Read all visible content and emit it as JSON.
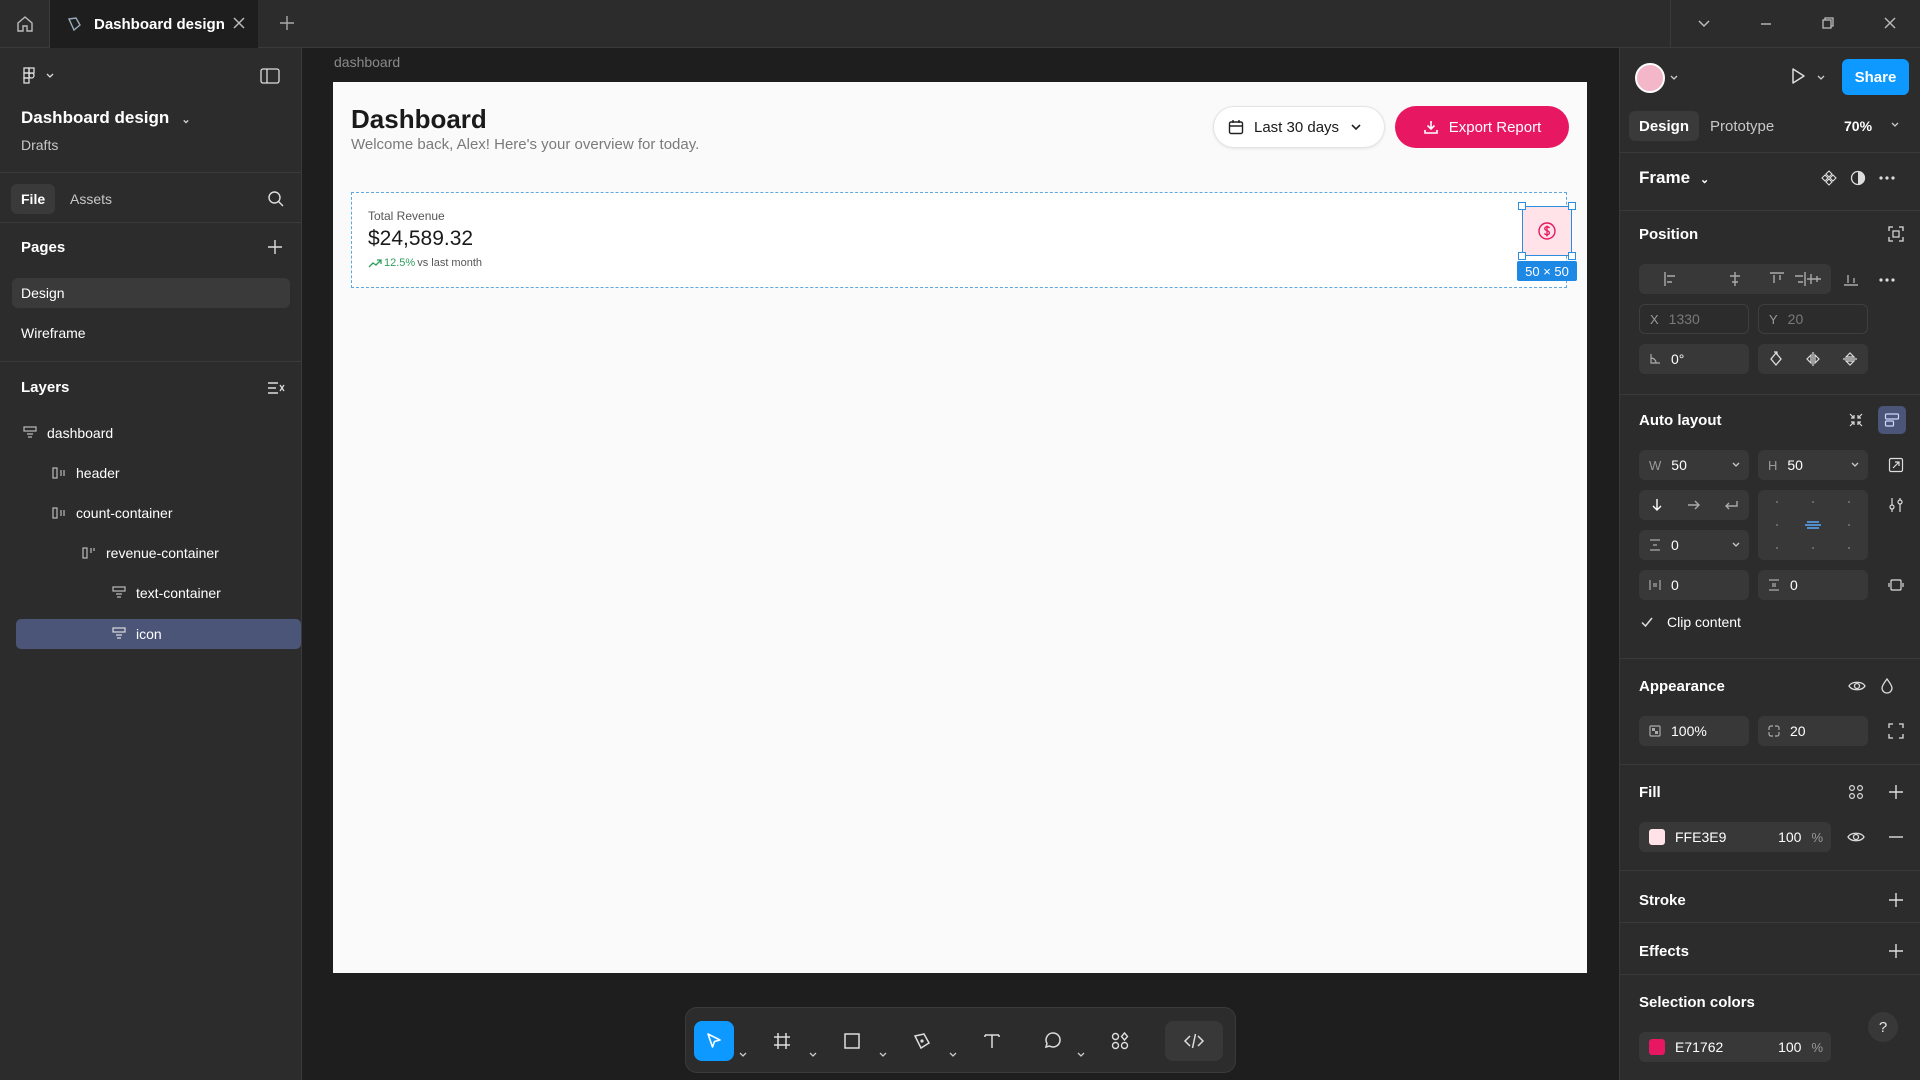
{
  "titlebar": {
    "tab_title": "Dashboard design"
  },
  "left_panel": {
    "project_title": "Dashboard design",
    "project_location": "Drafts",
    "tabs": [
      "File",
      "Assets"
    ],
    "pages_title": "Pages",
    "pages": [
      "Design",
      "Wireframe"
    ],
    "layers_title": "Layers",
    "layers": [
      "dashboard",
      "header",
      "count-container",
      "revenue-container",
      "text-container",
      "icon"
    ]
  },
  "canvas": {
    "frame_label": "dashboard",
    "dashboard": {
      "title": "Dashboard",
      "subtitle": "Welcome back, Alex! Here's your overview for today.",
      "range_label": "Last 30 days",
      "export_label": "Export Report",
      "card": {
        "label": "Total Revenue",
        "value": "$24,589.32",
        "change": "12.5%",
        "change_suffix": "vs last month"
      },
      "selection_size": "50 × 50"
    }
  },
  "right_panel": {
    "share_label": "Share",
    "tabs": [
      "Design",
      "Prototype"
    ],
    "zoom": "70%",
    "frame_label": "Frame",
    "position_title": "Position",
    "x": "1330",
    "y": "20",
    "rotation": "0°",
    "auto_layout_title": "Auto layout",
    "width": "50",
    "height": "50",
    "gap": "0",
    "padding_h": "0",
    "padding_v": "0",
    "clip_content": "Clip content",
    "appearance_title": "Appearance",
    "opacity": "100%",
    "radius": "20",
    "fill_title": "Fill",
    "fill_hex": "FFE3E9",
    "fill_opacity": "100",
    "percent": "%",
    "stroke_title": "Stroke",
    "effects_title": "Effects",
    "selection_colors_title": "Selection colors",
    "selection_color_hex": "E71762",
    "selection_color_opacity": "100",
    "help": "?"
  },
  "colors": {
    "accent": "#0d99ff",
    "brand": "#e71762",
    "fill": "#ffe3e9",
    "positive": "#2e9e5b"
  }
}
